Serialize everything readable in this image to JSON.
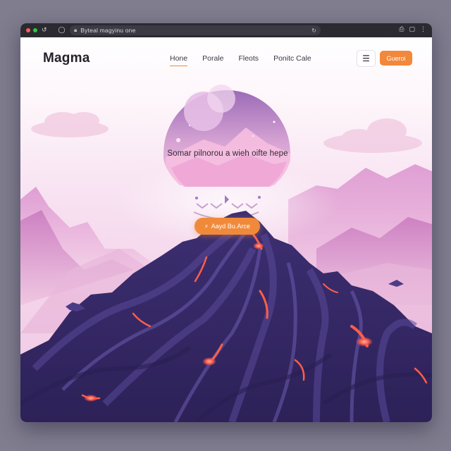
{
  "browser": {
    "url": "Byteal magyinu one",
    "back_icon": "back-arrow-icon",
    "lock_icon": "lock-icon"
  },
  "header": {
    "brand": "Magma",
    "nav": [
      {
        "label": "Hone",
        "active": true
      },
      {
        "label": "Porale",
        "active": false
      },
      {
        "label": "Fleots",
        "active": false
      },
      {
        "label": "Ponitc Cale",
        "active": false
      }
    ],
    "menu_icon": "hamburger-icon",
    "cta_label": "Gueroi"
  },
  "hero": {
    "text": "Somar pilnorou a wieh oifte hepe",
    "button_label": "Aayd Bu.Arce",
    "button_icon": "bolt-icon"
  },
  "colors": {
    "accent": "#f08a3a",
    "mountain": "#4a3a82",
    "lava": "#ff6a4a",
    "sky_pink": "#f3cfe6"
  }
}
